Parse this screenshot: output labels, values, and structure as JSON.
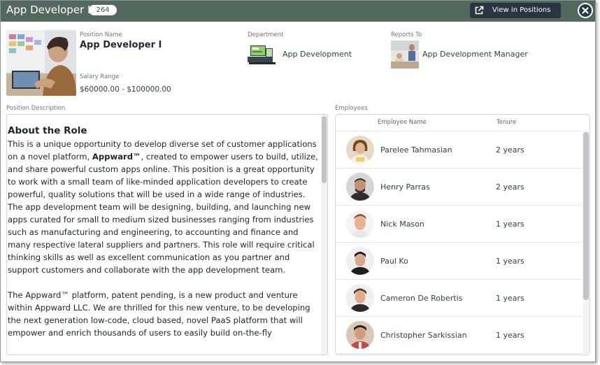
{
  "header": {
    "title": "App Developer I",
    "count": "264",
    "view_button_label": "View in Positions"
  },
  "position": {
    "name_label": "Position Name",
    "name": "App Developer I",
    "salary_label": "Salary Range",
    "salary": "$60000.00 - $100000.00"
  },
  "department": {
    "label": "Department",
    "name": "App Development"
  },
  "reports_to": {
    "label": "Reports To",
    "name": "App Development Manager"
  },
  "description": {
    "label": "Position Description",
    "heading": "About the Role",
    "p1_before": "This is a unique opportunity to develop diverse set of customer applications on a novel platform, ",
    "p1_bold": "Appward™",
    "p1_after": ", created to empower users to build, utilize, and share powerful custom apps online. This position is a great opportunity to work with a small team of like-minded application developers to create powerful, quality solutions that will be used in a wide range of industries. The app development team will be designing, building, and launching new apps curated for small to medium sized businesses ranging from industries such as manufacturing and engineering, to accounting and finance and many respective lateral suppliers and partners. This role will require critical thinking skills as well as excellent communication as you partner and support customers and collaborate with the app development team.",
    "p2": "The Appward™ platform, patent pending, is a new product and venture within Appward LLC. We are thrilled for this new venture, to be developing the next generation low-code, cloud based, novel PaaS platform that will empower and enrich thousands of users to easily build on-the-fly"
  },
  "employees": {
    "label": "Employees",
    "col_name": "Employee Name",
    "col_tenure": "Tenure",
    "rows": [
      {
        "name": "Parelee Tahmasian",
        "tenure": "2 years"
      },
      {
        "name": "Henry Parras",
        "tenure": "2 years"
      },
      {
        "name": "Nick Mason",
        "tenure": "1 years"
      },
      {
        "name": "Paul Ko",
        "tenure": "1 years"
      },
      {
        "name": "Cameron De Robertis",
        "tenure": "1 years"
      },
      {
        "name": "Christopher Sarkissian",
        "tenure": "1 years"
      }
    ]
  },
  "colors": {
    "header": "#54695e",
    "button": "#293540",
    "close": "#2b3946"
  }
}
